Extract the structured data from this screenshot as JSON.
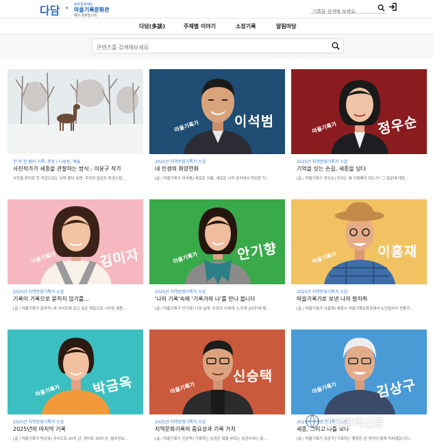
{
  "header": {
    "logo": "다담",
    "sub_logo_small": "원주문화재단",
    "sub_logo_main": "마을기록문화관",
    "sub_logo_tiny": "메이 문화헌나리",
    "search_placeholder": "기록을 검색해 보세요."
  },
  "nav": {
    "items": [
      "다담(多談)",
      "주제별 이야기",
      "소장기록",
      "알림마당"
    ]
  },
  "main_search": {
    "placeholder": "콘텐츠를 검색해보세요"
  },
  "cards": [
    {
      "category": "한 주 한 줌의 기록, 주암 / 나성동, 예술",
      "title": "사진작가가 세종을 관찰하는 방식 : 이윤구 작가",
      "desc": "사진을 취미로 한 작업으로는 오래 됐다 보면, 주위의 일상도 파견스럽...",
      "tag": "",
      "name": "",
      "bg": "#e9eef2"
    },
    {
      "category": "2025년 지역문화기록가 소감",
      "title": "내 인생의 화양연화",
      "desc": "[글 / 마을기록가 이석범]  새로운 이름, 새로운 시작 궁치에서 퇴임한 지...",
      "tag": "마을기록가",
      "name": "이석범",
      "bg": "#1f4d73"
    },
    {
      "category": "2025년 지역문화기록가 소감",
      "title": "기억을 잇는 손길, 세종을 담다",
      "desc": "[글 / 마을기록가 정우순]  우리는 왜 기록해야 하는가? 그 질문에 대한...",
      "tag": "마을기록가",
      "name": "정우순",
      "bg": "#8a1c1f"
    },
    {
      "category": "2025년 지역문화기록가 소감",
      "title": "기록이 기록으로 묻히지 않기를...",
      "desc": "[글 / 마을기록가 김미자]  세 아이트에 살고 싶은 목립으로 시작된 세종...",
      "tag": "마을기록가",
      "name": "김미자",
      "bg": "#f5b8c0"
    },
    {
      "category": "2025년 지역문화기록가 소감",
      "title": "'나의 기록'속에 '기록가의 나'를 만나 봅니다",
      "desc": "[글 / 마을기록가 안기향]  나의 실제 '오로이 나에게, 느리게 10년'에 제...",
      "tag": "마을기록가",
      "name": "안기향",
      "bg": "#3aa94a"
    },
    {
      "category": "2025년 지역문화기록가 소감",
      "title": "마을기록가로 보낸 나의 발자취",
      "desc": "[글 / 마을기록가 이홍재]  세종시 마을기록문화관에서 노인일자리 전용가...",
      "tag": "마을기록가",
      "name": "이홍재",
      "bg": "#f0c261"
    },
    {
      "category": "2025년 지역문화기록가 소감",
      "title": "2025년의 마지막 기록",
      "desc": "[글 / 마을기록가 박금옥]  자식으로 20여 년, 영어로 30여 년, 발부장보...",
      "tag": "마을기록가",
      "name": "박금옥",
      "bg": "#3cbfc0"
    },
    {
      "category": "2025년 지역문화기록가 소감",
      "title": "지역문화기록의 중요성과 기록 가치",
      "desc": "[글 / 마을기록가 신승택]  기록하는 습관은 복을 부르는 습관이라는 말...",
      "tag": "마을기록가",
      "name": "신승택",
      "bg": "#c95a3c"
    },
    {
      "category": "2025년 지역문화기록가 소감",
      "title": "세종, 그리고 나를 보다",
      "desc": "[글 / 마을기록가 김상구]  기록하는 행정은 곧 생각이 밝게 미치겠습니다...",
      "tag": "마을기록가",
      "name": "김상구",
      "bg": "#4a9ad6"
    }
  ],
  "watermark": "인천광역신문",
  "colors": {
    "accent": "#2a6fc6",
    "category": "#3a7bd5"
  }
}
